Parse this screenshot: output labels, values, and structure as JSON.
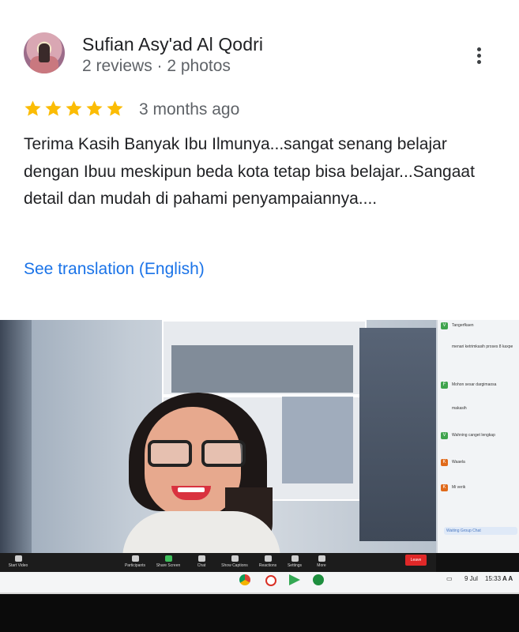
{
  "review": {
    "reviewer_name": "Sufian Asy'ad Al Qodri",
    "reviewer_meta": "2 reviews · 2 photos",
    "rating": 5,
    "rating_max": 5,
    "star_color": "#fbbc04",
    "time": "3 months ago",
    "text": "Terima Kasih Banyak Ibu Ilmunya...sangat senang belajar dengan Ibuu meskipun beda kota tetap bisa belajar...Sangaat detail dan mudah di pahami penyampaiannya....",
    "translate_link": "See translation (English)",
    "more_icon": "more-vert-icon"
  },
  "zoom": {
    "toolbar": {
      "start_video": "Start Video",
      "participants": "Participants",
      "participants_count": "27",
      "share_screen": "Share Screen",
      "chat": "Chat",
      "show_captions": "Show Captions",
      "reactions": "Reactions",
      "settings": "Settings",
      "more": "More",
      "leave": "Leave"
    },
    "chat": {
      "messages": [
        {
          "initial": "V",
          "color": "#3fa34d",
          "text": "Tangerfkaen"
        },
        {
          "initial": "",
          "color": "#777777",
          "text": "menari ketrimkasih proses 8 kaxpe"
        },
        {
          "initial": "F",
          "color": "#3fa34d",
          "text": "Mohon sesar dargimaosa"
        },
        {
          "initial": "",
          "color": "#333333",
          "text": "makasih"
        },
        {
          "initial": "V",
          "color": "#3fa34d",
          "text": "Wahning canget lengkap"
        },
        {
          "initial": "K",
          "color": "#e06a1a",
          "text": "Waaela"
        },
        {
          "initial": "K",
          "color": "#e06a1a",
          "text": "Mi verik"
        }
      ],
      "input_label": "Waiting Group Chat"
    }
  },
  "taskbar": {
    "date": "9 Jul",
    "clock": "15:33",
    "indicators": "A A"
  }
}
